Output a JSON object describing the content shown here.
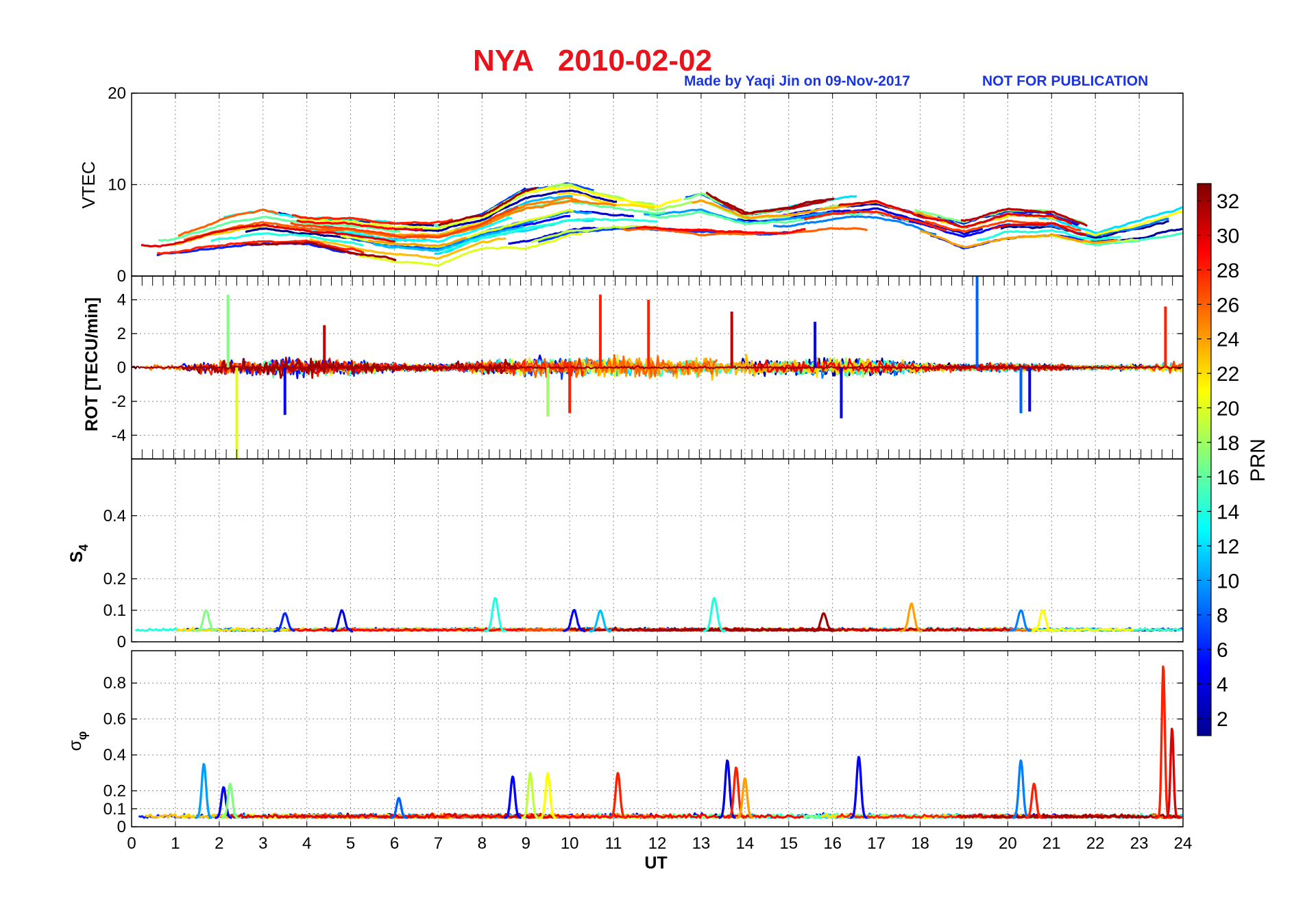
{
  "title": {
    "main": "NYA   2010-02-02",
    "credit": "Made by Yaqi Jin on 09-Nov-2017",
    "note": "NOT FOR PUBLICATION"
  },
  "colors": {
    "title": "#e8131b",
    "credit": "#1a35e0",
    "grid": "#8a8a8a"
  },
  "chart_data": [
    {
      "type": "line",
      "panel": "vtec",
      "ylabel": "VTEC",
      "ylim": [
        0,
        20
      ],
      "yticks": [
        0,
        10,
        20
      ],
      "xlim": [
        0,
        24
      ],
      "grid": true,
      "series_prn_values": [
        1,
        2,
        3,
        4,
        5,
        6,
        7,
        8,
        9,
        10,
        11,
        12,
        13,
        14,
        15,
        16,
        17,
        18,
        19,
        20,
        21,
        22,
        23,
        24,
        25,
        26,
        27,
        28,
        29,
        30,
        31,
        32
      ],
      "typical_range": [
        2,
        10.5
      ],
      "approx_profile": {
        "x": [
          0,
          1,
          2,
          3,
          4,
          5,
          6,
          7,
          8,
          9,
          10,
          11,
          12,
          13,
          14,
          15,
          16,
          17,
          18,
          19,
          20,
          21,
          22,
          23,
          24
        ],
        "min": [
          2,
          2.5,
          3,
          3.5,
          3.5,
          2.5,
          1.5,
          1,
          3,
          3,
          4.5,
          5,
          5,
          4.5,
          4.5,
          4.5,
          5,
          5,
          4,
          2,
          3,
          3.5,
          3,
          3,
          3.5
        ],
        "max": [
          4.5,
          4.5,
          6.5,
          7.5,
          6.5,
          6.5,
          6,
          6,
          7,
          10,
          10.5,
          9,
          8,
          9.5,
          7,
          7.5,
          8.5,
          9,
          7.5,
          6.5,
          8,
          7.5,
          5.5,
          7.5,
          9.5
        ]
      }
    },
    {
      "type": "line",
      "panel": "rot",
      "ylabel": "ROT [TECU/min]",
      "ylim": [
        -5.4,
        5.4
      ],
      "yticks": [
        -4,
        -2,
        0,
        2,
        4
      ],
      "xlim": [
        0,
        24
      ],
      "grid": true,
      "spikes": [
        {
          "x": 2.2,
          "y": 4.3,
          "prn": 17
        },
        {
          "x": 2.4,
          "y": -5.4,
          "prn": 20
        },
        {
          "x": 3.5,
          "y": -2.8,
          "prn": 5
        },
        {
          "x": 4.4,
          "y": 2.5,
          "prn": 31
        },
        {
          "x": 9.5,
          "y": -2.9,
          "prn": 18
        },
        {
          "x": 10.0,
          "y": -2.7,
          "prn": 28
        },
        {
          "x": 10.7,
          "y": 4.3,
          "prn": 28
        },
        {
          "x": 11.8,
          "y": 4.0,
          "prn": 28
        },
        {
          "x": 13.7,
          "y": 3.3,
          "prn": 31
        },
        {
          "x": 15.6,
          "y": 2.7,
          "prn": 5
        },
        {
          "x": 16.2,
          "y": -3.0,
          "prn": 4
        },
        {
          "x": 19.3,
          "y": 5.4,
          "prn": 8
        },
        {
          "x": 20.3,
          "y": -2.7,
          "prn": 8
        },
        {
          "x": 20.5,
          "y": -2.6,
          "prn": 4
        },
        {
          "x": 23.6,
          "y": 3.6,
          "prn": 28
        }
      ]
    },
    {
      "type": "line",
      "panel": "s4",
      "ylabel": "S4",
      "ylabel_main": "S",
      "ylabel_sub": "4",
      "ylim": [
        0,
        0.58
      ],
      "yticks": [
        0,
        0.1,
        0.2,
        0.4
      ],
      "xlim": [
        0,
        24
      ],
      "grid": true,
      "baseline": 0.035,
      "peaks": [
        {
          "x": 1.7,
          "y": 0.1,
          "prn": 17
        },
        {
          "x": 3.5,
          "y": 0.09,
          "prn": 6
        },
        {
          "x": 4.8,
          "y": 0.1,
          "prn": 4
        },
        {
          "x": 8.3,
          "y": 0.14,
          "prn": 14
        },
        {
          "x": 10.1,
          "y": 0.1,
          "prn": 5
        },
        {
          "x": 10.7,
          "y": 0.1,
          "prn": 11
        },
        {
          "x": 13.3,
          "y": 0.14,
          "prn": 14
        },
        {
          "x": 15.8,
          "y": 0.09,
          "prn": 32
        },
        {
          "x": 17.8,
          "y": 0.12,
          "prn": 24
        },
        {
          "x": 20.3,
          "y": 0.1,
          "prn": 9
        },
        {
          "x": 20.8,
          "y": 0.1,
          "prn": 21
        }
      ]
    },
    {
      "type": "line",
      "panel": "sigma_phi",
      "ylabel": "σφ",
      "ylabel_main": "σ",
      "ylabel_sub": "φ",
      "xlabel": "UT",
      "ylim": [
        0,
        0.98
      ],
      "yticks": [
        0,
        0.1,
        0.2,
        0.4,
        0.6,
        0.8
      ],
      "xlim": [
        0,
        24
      ],
      "xticks": [
        0,
        1,
        2,
        3,
        4,
        5,
        6,
        7,
        8,
        9,
        10,
        11,
        12,
        13,
        14,
        15,
        16,
        17,
        18,
        19,
        20,
        21,
        22,
        23,
        24
      ],
      "grid": true,
      "baseline": 0.05,
      "peaks": [
        {
          "x": 1.65,
          "y": 0.35,
          "prn": 10
        },
        {
          "x": 2.1,
          "y": 0.22,
          "prn": 5
        },
        {
          "x": 2.25,
          "y": 0.24,
          "prn": 17
        },
        {
          "x": 6.1,
          "y": 0.16,
          "prn": 8
        },
        {
          "x": 8.7,
          "y": 0.28,
          "prn": 5
        },
        {
          "x": 9.1,
          "y": 0.3,
          "prn": 19
        },
        {
          "x": 9.5,
          "y": 0.3,
          "prn": 21
        },
        {
          "x": 11.1,
          "y": 0.3,
          "prn": 28
        },
        {
          "x": 13.6,
          "y": 0.37,
          "prn": 4
        },
        {
          "x": 13.8,
          "y": 0.33,
          "prn": 28
        },
        {
          "x": 14.0,
          "y": 0.27,
          "prn": 24
        },
        {
          "x": 16.6,
          "y": 0.39,
          "prn": 5
        },
        {
          "x": 20.3,
          "y": 0.37,
          "prn": 9
        },
        {
          "x": 20.6,
          "y": 0.24,
          "prn": 28
        },
        {
          "x": 23.55,
          "y": 0.9,
          "prn": 28
        },
        {
          "x": 23.75,
          "y": 0.55,
          "prn": 30
        }
      ]
    },
    {
      "type": "heatmap",
      "panel": "colorbar",
      "label": "PRN",
      "range": [
        1,
        33
      ],
      "ticks": [
        2,
        4,
        6,
        8,
        10,
        12,
        14,
        16,
        18,
        20,
        22,
        24,
        26,
        28,
        30,
        32
      ],
      "colormap": "jet"
    }
  ]
}
